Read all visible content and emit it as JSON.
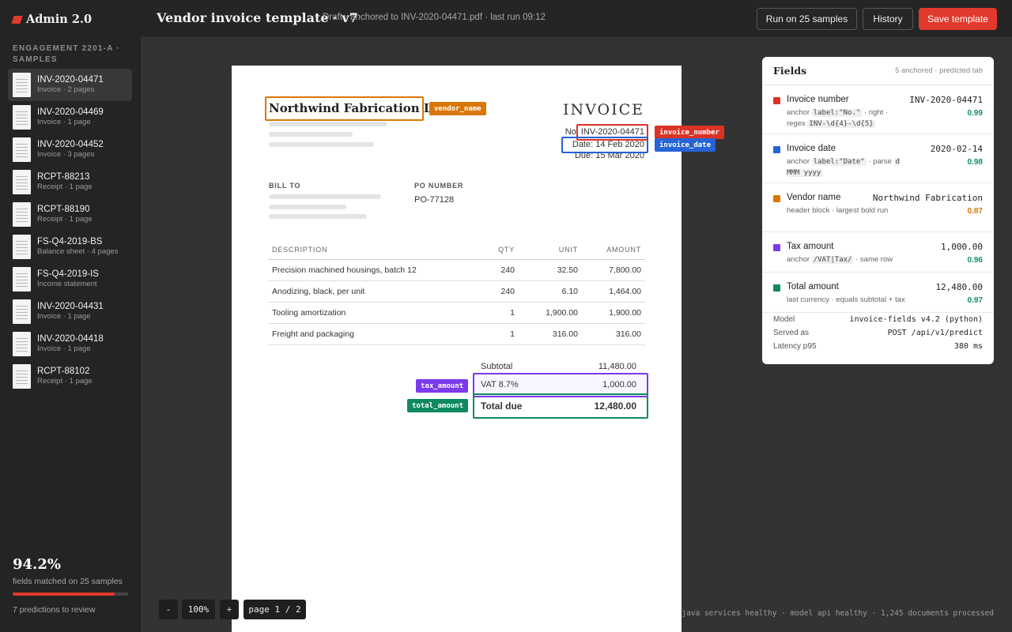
{
  "app": {
    "name": "Admin 2.0"
  },
  "sidebar": {
    "engagement": "ENGAGEMENT 2201-A · SAMPLES",
    "samples": [
      {
        "id": "INV-2020-04471",
        "meta": "Invoice · 2 pages",
        "active": true
      },
      {
        "id": "INV-2020-04469",
        "meta": "Invoice · 1 page"
      },
      {
        "id": "INV-2020-04452",
        "meta": "Invoice · 3 pages"
      },
      {
        "id": "RCPT-88213",
        "meta": "Receipt · 1 page"
      },
      {
        "id": "RCPT-88190",
        "meta": "Receipt · 1 page"
      },
      {
        "id": "FS-Q4-2019-BS",
        "meta": "Balance sheet · 4 pages"
      },
      {
        "id": "FS-Q4-2019-IS",
        "meta": "Income statement"
      },
      {
        "id": "INV-2020-04431",
        "meta": "Invoice · 1 page"
      },
      {
        "id": "INV-2020-04418",
        "meta": "Invoice · 1 page"
      },
      {
        "id": "RCPT-88102",
        "meta": "Receipt · 1 page"
      }
    ],
    "stats": {
      "match_pct": "94.2%",
      "match_fraction": 0.942,
      "match_label": "fields matched on 25 samples",
      "review": "7 predictions to review"
    }
  },
  "header": {
    "title": "Vendor invoice template · v7",
    "meta": "Draft · anchored to INV-2020-04471.pdf · last run 09:12",
    "run_label": "Run on 25 samples",
    "history_label": "History",
    "save_label": "Save template"
  },
  "document": {
    "vendor": "Northwind Fabrication Ltd",
    "title": "INVOICE",
    "number": "No. INV-2020-04471",
    "date": "Date: 14 Feb 2020",
    "due": "Due: 15 Mar 2020",
    "bill_to_label": "BILL TO",
    "po_label": "PO NUMBER",
    "po_value": "PO-77128",
    "columns": [
      "DESCRIPTION",
      "QTY",
      "UNIT",
      "AMOUNT"
    ],
    "rows": [
      [
        "Precision machined housings, batch 12",
        "240",
        "32.50",
        "7,800.00"
      ],
      [
        "Anodizing, black, per unit",
        "240",
        "6.10",
        "1,464.00"
      ],
      [
        "Tooling amortization",
        "1",
        "1,900.00",
        "1,900.00"
      ],
      [
        "Freight and packaging",
        "1",
        "316.00",
        "316.00"
      ]
    ],
    "subtotal_label": "Subtotal",
    "subtotal": "11,480.00",
    "vat_label": "VAT 8.7%",
    "vat": "1,000.00",
    "total_label": "Total due",
    "total": "12,480.00"
  },
  "overlays": {
    "vendor_name": "vendor_name",
    "invoice_number": "invoice_number",
    "invoice_date": "invoice_date",
    "tax_amount": "tax_amount",
    "total_amount": "total_amount"
  },
  "fields_panel": {
    "title": "Fields",
    "subtitle": "5 anchored · predicted tab",
    "fields": [
      {
        "name": "Invoice number",
        "value": "INV-2020-04471",
        "color": "#dc3226",
        "desc_pre": "anchor ",
        "code1": "label:\"No.\"",
        "desc_mid": " · right · regex ",
        "code2": "INV-\\d{4}-\\d{5}",
        "desc_post": "",
        "conf": "0.99",
        "conf_color": "#12915a"
      },
      {
        "name": "Invoice date",
        "value": "2020-02-14",
        "color": "#2563d6",
        "desc_pre": "anchor ",
        "code1": "label:\"Date\"",
        "desc_mid": " · parse ",
        "code2": "d MMM yyyy",
        "desc_post": "",
        "conf": "0.98",
        "conf_color": "#12915a"
      },
      {
        "name": "Vendor name",
        "value": "Northwind Fabrication",
        "color": "#d97706",
        "desc_pre": "header block · largest bold run",
        "code1": "",
        "desc_mid": "",
        "code2": "",
        "desc_post": "",
        "conf": "0.87",
        "conf_color": "#d97706"
      },
      {
        "name": "Tax amount",
        "value": "1,000.00",
        "color": "#7c3aed",
        "desc_pre": "anchor ",
        "code1": "/VAT|Tax/",
        "desc_mid": " · same row",
        "code2": "",
        "desc_post": "",
        "conf": "0.96",
        "conf_color": "#12915a"
      },
      {
        "name": "Total amount",
        "value": "12,480.00",
        "color": "#0f8a5f",
        "desc_pre": "last currency · equals subtotal + tax",
        "code1": "",
        "desc_mid": "",
        "code2": "",
        "desc_post": "",
        "conf": "0.97",
        "conf_color": "#12915a"
      }
    ],
    "meta": [
      {
        "label": "Model",
        "value": "invoice-fields v4.2 (python)"
      },
      {
        "label": "Served as",
        "value": "POST /api/v1/predict"
      },
      {
        "label": "Latency p95",
        "value": "380 ms"
      }
    ]
  },
  "zoom": {
    "minus": "-",
    "level": "100%",
    "plus": "+",
    "page": "page 1 / 2"
  },
  "footer": "java services healthy · model api healthy · 1,245 documents processed",
  "colors": {
    "accent": "#e03a2c",
    "vendor": "#d97706",
    "number": "#dc3226",
    "date": "#2563d6",
    "tax": "#7c3aed",
    "total": "#0f8a5f"
  }
}
